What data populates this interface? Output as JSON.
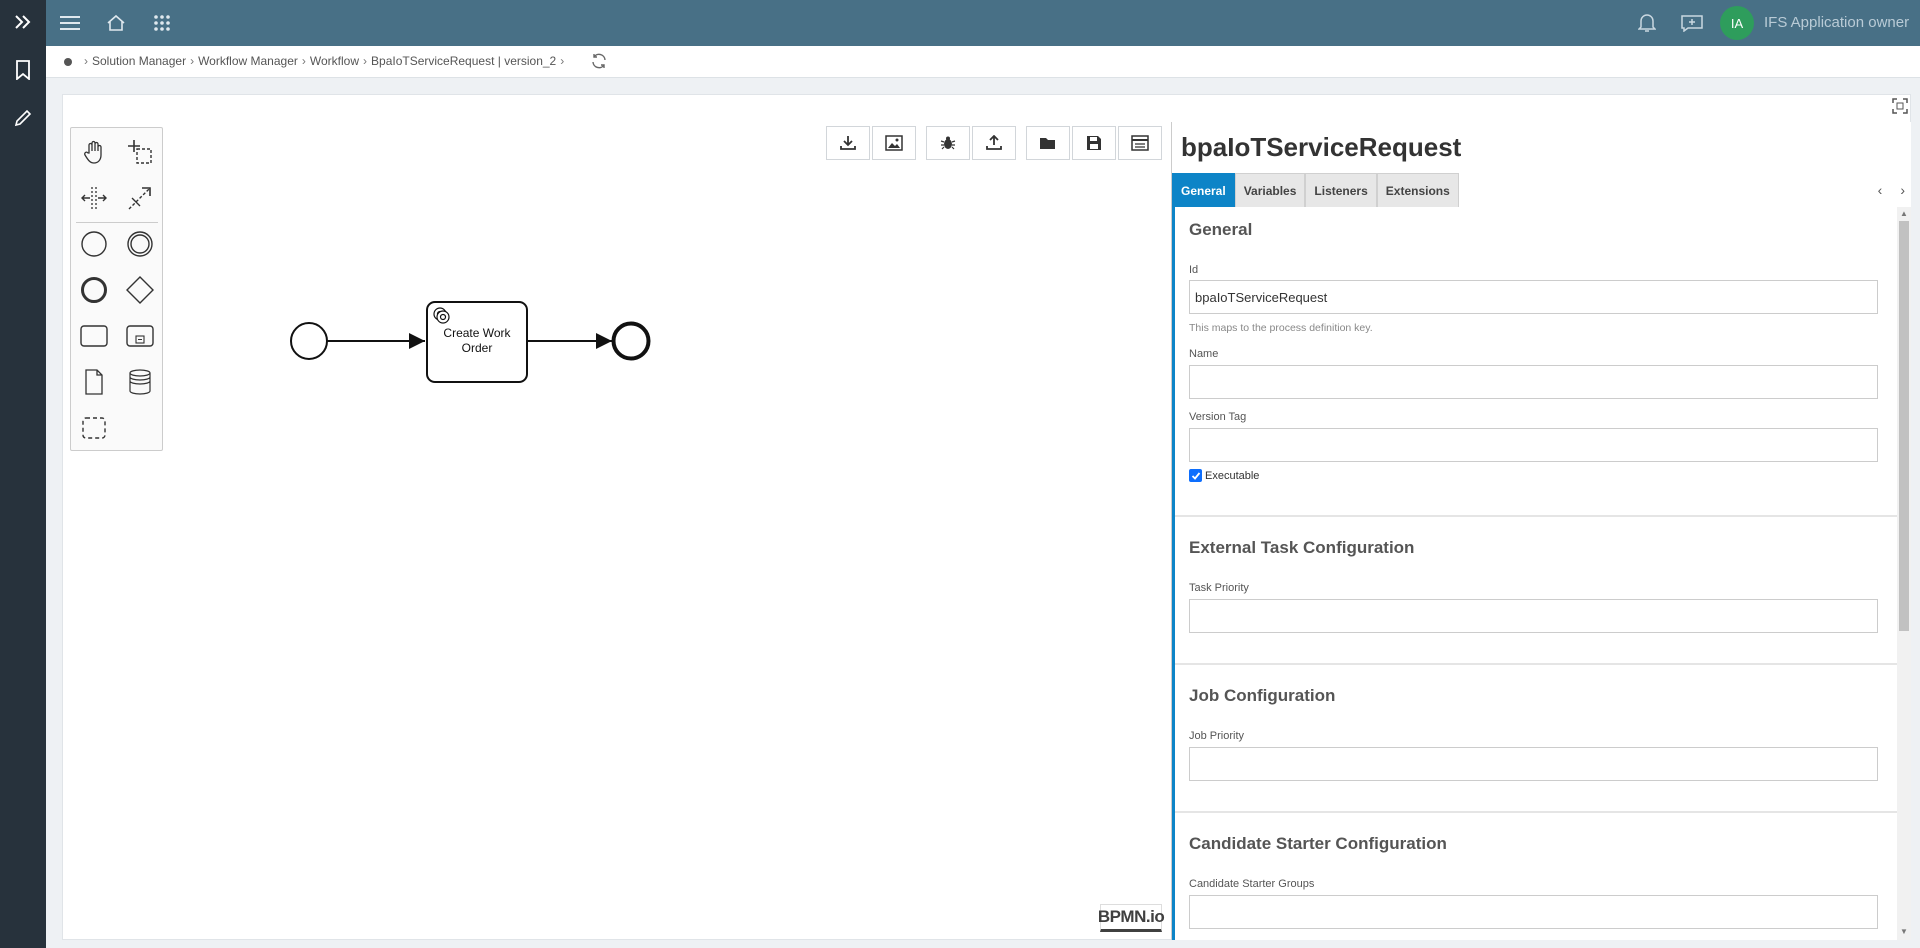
{
  "topbar": {
    "user_initials": "IA",
    "user_name": "IFS Application owner"
  },
  "breadcrumb": {
    "items": [
      "Solution Manager",
      "Workflow Manager",
      "Workflow",
      "BpaIoTServiceRequest | version_2"
    ]
  },
  "diagram": {
    "task_label_line1": "Create Work",
    "task_label_line2": "Order",
    "logo_text": "BPMN.io"
  },
  "properties": {
    "title": "bpaIoTServiceRequest",
    "tabs": [
      "General",
      "Variables",
      "Listeners",
      "Extensions"
    ],
    "active_tab": "General",
    "general": {
      "group_title": "General",
      "id_label": "Id",
      "id_value": "bpaIoTServiceRequest",
      "id_description": "This maps to the process definition key.",
      "name_label": "Name",
      "name_value": "",
      "version_tag_label": "Version Tag",
      "version_tag_value": "",
      "executable_label": "Executable",
      "executable_checked": true
    },
    "external_task": {
      "group_title": "External Task Configuration",
      "task_priority_label": "Task Priority",
      "task_priority_value": ""
    },
    "job": {
      "group_title": "Job Configuration",
      "job_priority_label": "Job Priority",
      "job_priority_value": ""
    },
    "candidate": {
      "group_title": "Candidate Starter Configuration",
      "groups_label": "Candidate Starter Groups",
      "groups_value": ""
    }
  },
  "colors": {
    "topbar": "#487086",
    "rail": "#27323c",
    "accent": "#0d84c7",
    "avatar": "#2e9d5c"
  }
}
